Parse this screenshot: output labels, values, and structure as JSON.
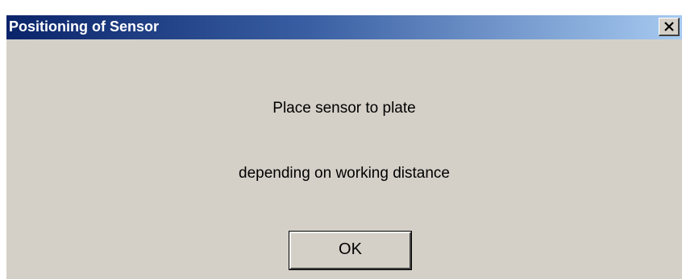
{
  "window": {
    "title": "Positioning of Sensor",
    "close_icon": "close-icon"
  },
  "message": {
    "line1": "Place sensor to plate",
    "line2": "depending on working distance"
  },
  "buttons": {
    "ok_label": "OK"
  },
  "colors": {
    "title_bar_start": "#0a246a",
    "title_bar_end": "#a6caf0",
    "dialog_background": "#d4d0c8",
    "title_text": "#ffffff"
  }
}
